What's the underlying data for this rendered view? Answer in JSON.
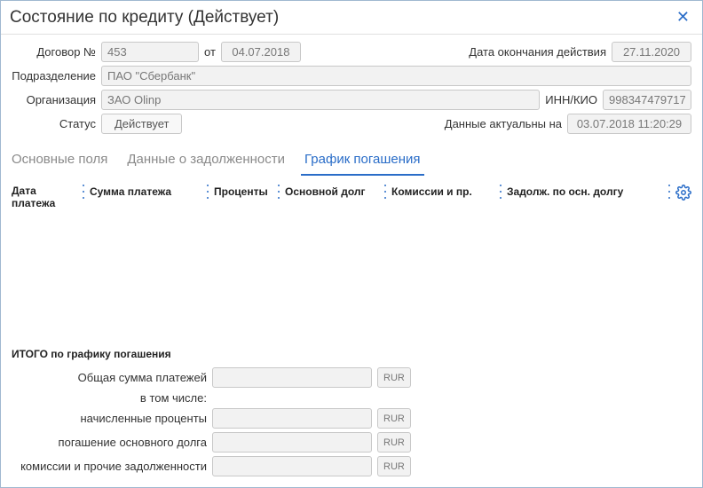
{
  "window": {
    "title": "Состояние по кредиту (Действует)"
  },
  "form": {
    "contract_label": "Договор №",
    "contract_number": "453",
    "from_label": "от",
    "contract_date": "04.07.2018",
    "expiry_label": "Дата окончания действия",
    "expiry_date": "27.11.2020",
    "division_label": "Подразделение",
    "division_value": "ПАО \"Сбербанк\"",
    "organization_label": "Организация",
    "organization_value": "ЗАО Olinp",
    "inn_label": "ИНН/КИО",
    "inn_value": "998347479717",
    "status_label": "Статус",
    "status_value": "Действует",
    "actual_label": "Данные актуальны на",
    "actual_value": "03.07.2018 11:20:29"
  },
  "tabs": [
    {
      "label": "Основные поля"
    },
    {
      "label": "Данные о задолженности"
    },
    {
      "label": "График погашения"
    }
  ],
  "grid": {
    "columns": [
      "Дата платежа",
      "Сумма платежа",
      "Проценты",
      "Основной долг",
      "Комиссии и пр.",
      "Задолж. по осн. долгу"
    ]
  },
  "totals": {
    "header": "ИТОГО по графику погашения",
    "currency": "RUR",
    "rows": {
      "total_sum_label": "Общая сумма платежей",
      "including_label": "в том числе:",
      "accrued_interest_label": "начисленные проценты",
      "principal_repay_label": "погашение основного долга",
      "fees_debt_label": "комиссии и прочие задолженности"
    }
  }
}
